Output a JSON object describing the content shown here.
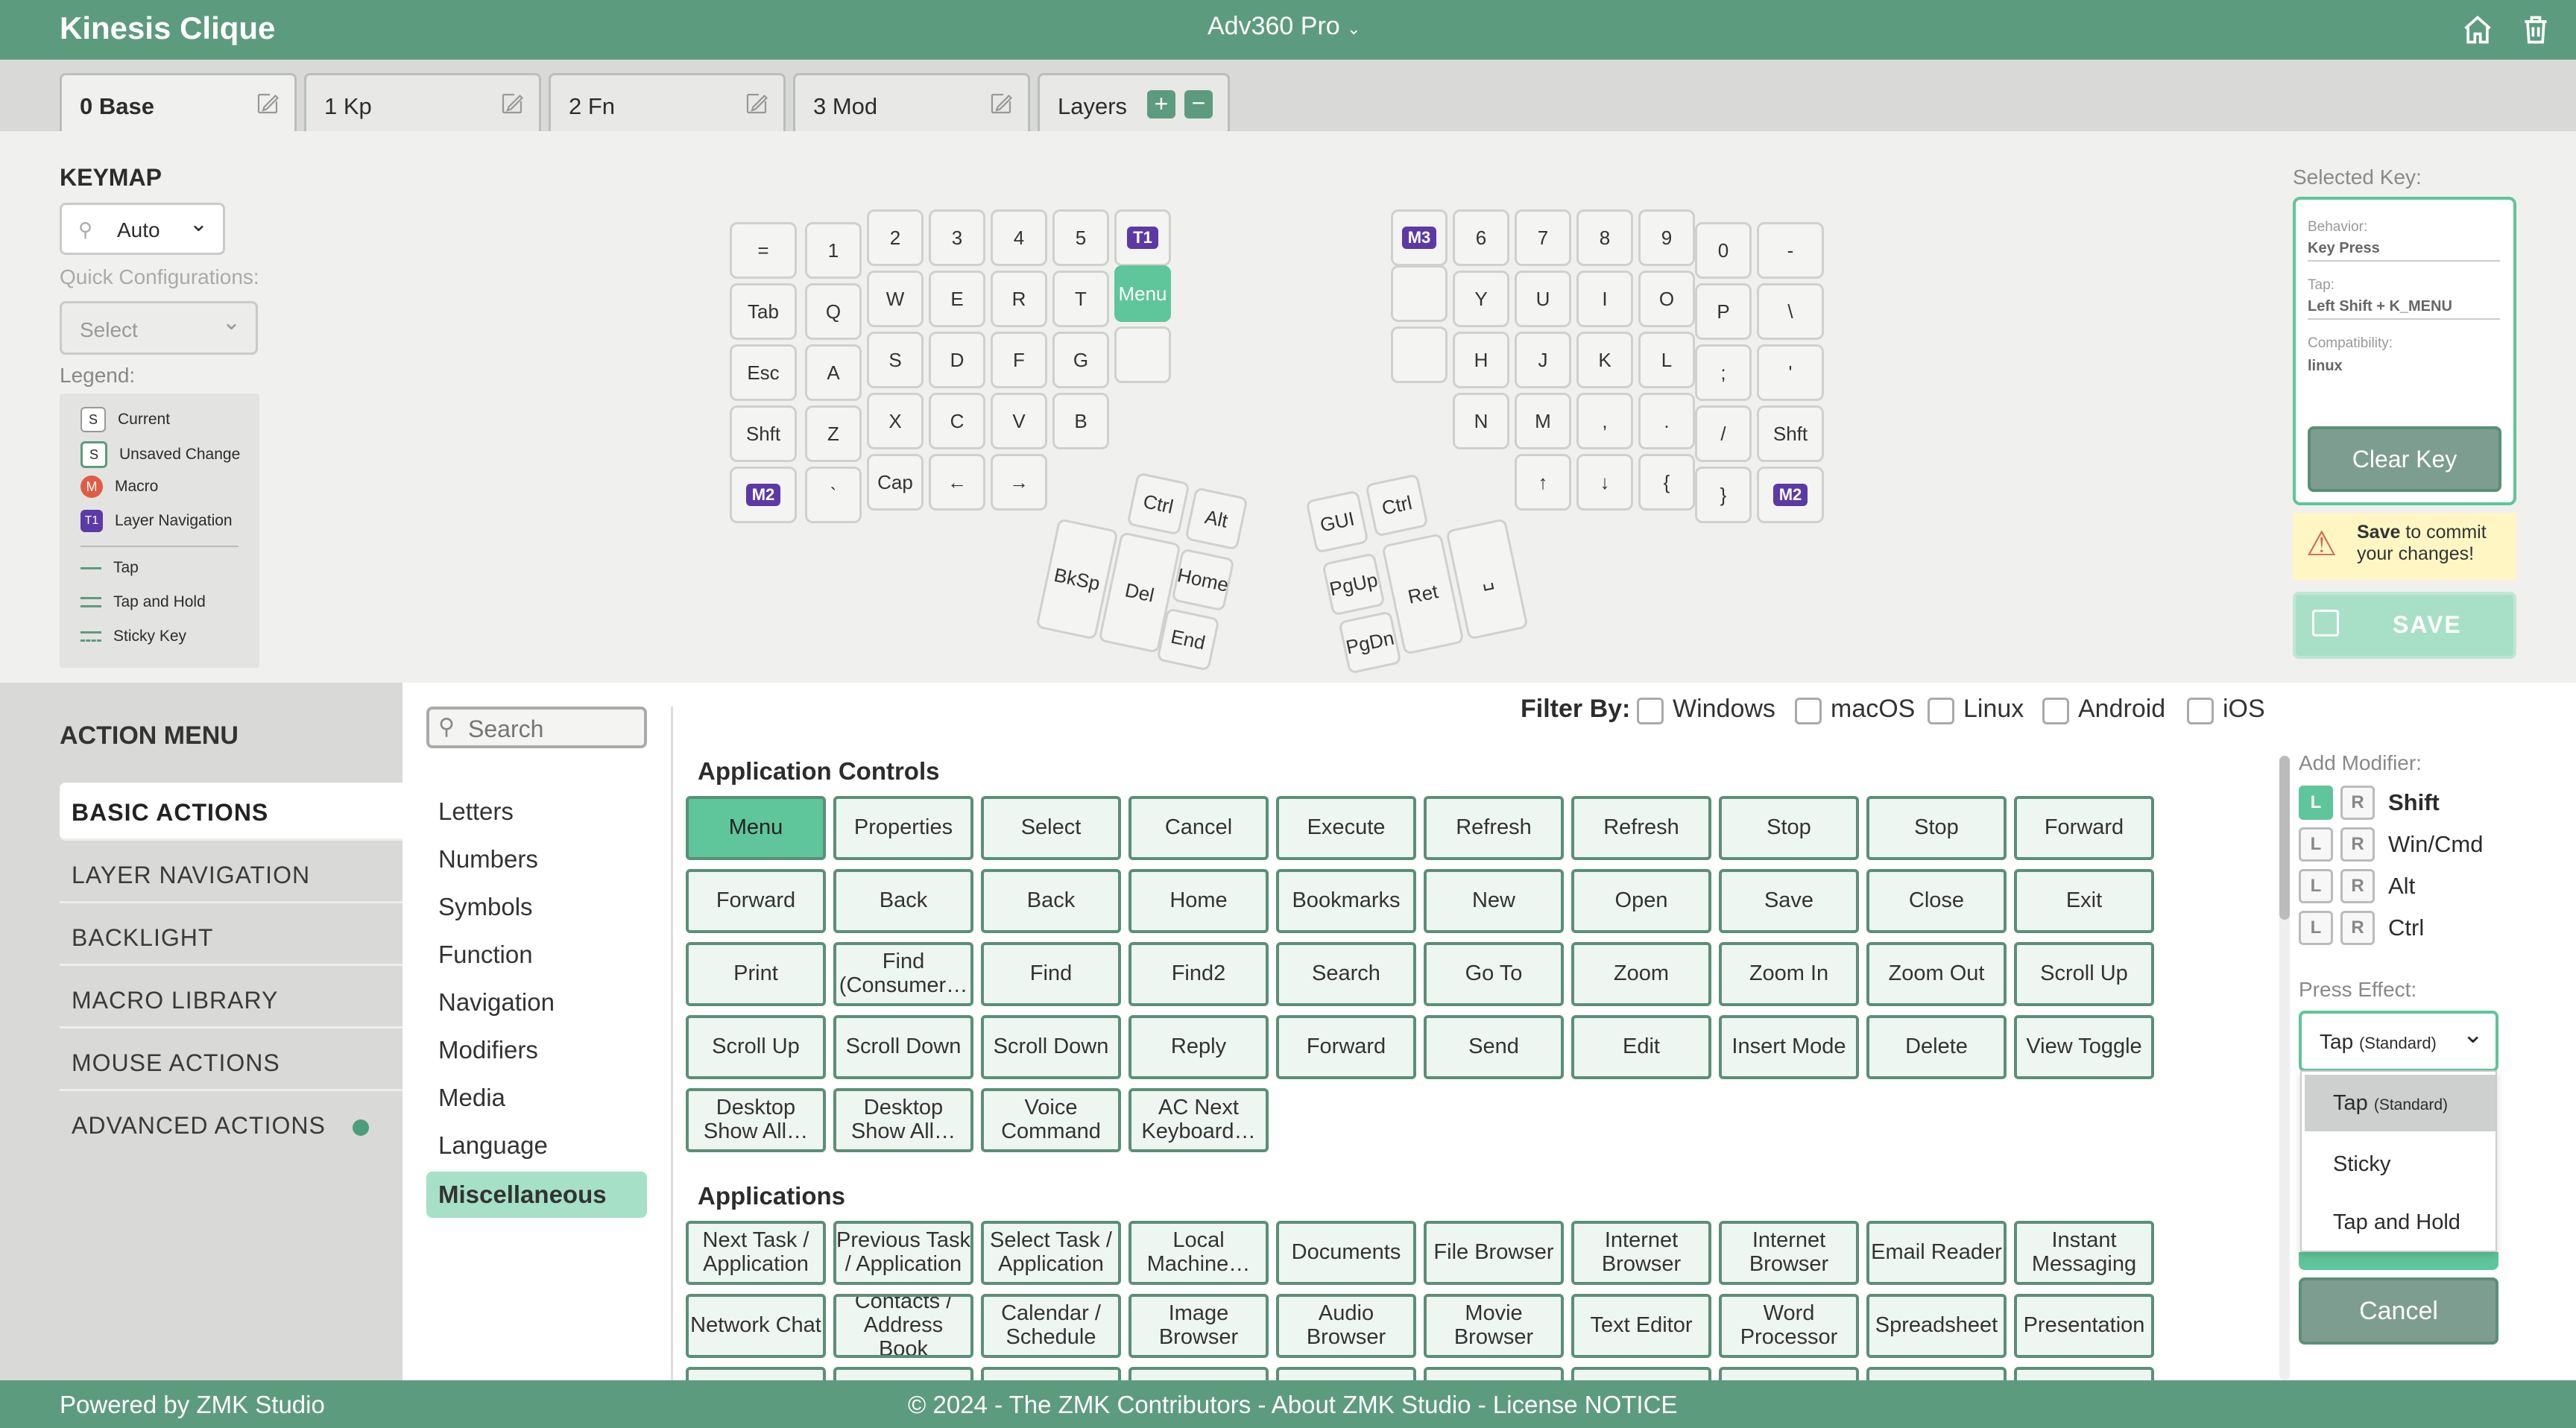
{
  "header": {
    "app_title": "Kinesis Clique",
    "device_name": "Adv360 Pro",
    "home_icon": "home-icon",
    "delete_icon": "trash-icon"
  },
  "tabs": [
    {
      "label": "0 Base",
      "active": true
    },
    {
      "label": "1 Kp"
    },
    {
      "label": "2 Fn"
    },
    {
      "label": "3 Mod"
    }
  ],
  "layers_label": "Layers",
  "keymap": {
    "title": "KEYMAP",
    "mode": "Auto",
    "quick_config_label": "Quick Configurations:",
    "quick_config_value": "Select",
    "legend_label": "Legend:",
    "legend": [
      {
        "sym": "S",
        "label": "Current"
      },
      {
        "sym": "S",
        "label": "Unsaved Change"
      },
      {
        "sym": "M",
        "label": "Macro"
      },
      {
        "sym": "T1",
        "label": "Layer Navigation"
      },
      {
        "sym": "",
        "label": "Tap"
      },
      {
        "sym": "",
        "label": "Tap and Hold"
      },
      {
        "sym": "",
        "label": "Sticky Key"
      }
    ]
  },
  "keys_left": [
    "=",
    "1",
    "2",
    "3",
    "4",
    "5",
    "T1",
    "Tab",
    "Q",
    "W",
    "E",
    "R",
    "T",
    "Menu",
    "Esc",
    "A",
    "S",
    "D",
    "F",
    "G",
    "",
    "Shft",
    "Z",
    "X",
    "C",
    "V",
    "B",
    "M2",
    "`",
    "Cap",
    "←",
    "→",
    "Ctrl",
    "Alt",
    "BkSp",
    "Del",
    "Home",
    "End"
  ],
  "keys_right": [
    "M3",
    "6",
    "7",
    "8",
    "9",
    "0",
    "-",
    "",
    "Y",
    "U",
    "I",
    "O",
    "P",
    "\\",
    "",
    "H",
    "J",
    "K",
    "L",
    ";",
    "'",
    "N",
    "M",
    ",",
    ".",
    "/",
    "Shft",
    "↑",
    "↓",
    "{",
    "}",
    "M2",
    "GUI",
    "Ctrl",
    "PgUp",
    "PgDn",
    "Ret",
    "␣"
  ],
  "selected_key": {
    "title": "Selected Key:",
    "behavior_label": "Behavior:",
    "behavior": "Key Press",
    "tap_label": "Tap:",
    "tap": "Left Shift + K_MENU",
    "compat_label": "Compatibility:",
    "compat": "linux",
    "clear_label": "Clear Key",
    "warn_bold": "Save",
    "warn_rest": " to commit your changes!",
    "save_label": "SAVE"
  },
  "action_menu": {
    "title": "ACTION MENU",
    "items": [
      "BASIC ACTIONS",
      "LAYER NAVIGATION",
      "BACKLIGHT",
      "MACRO LIBRARY",
      "MOUSE ACTIONS",
      "ADVANCED ACTIONS"
    ]
  },
  "search_placeholder": "Search",
  "categories": [
    "Letters",
    "Numbers",
    "Symbols",
    "Function",
    "Navigation",
    "Modifiers",
    "Media",
    "Language",
    "Miscellaneous"
  ],
  "filter": {
    "label": "Filter By:",
    "options": [
      "Windows",
      "macOS",
      "Linux",
      "Android",
      "iOS"
    ]
  },
  "app_controls": {
    "title": "Application Controls",
    "buttons": [
      "Menu",
      "Properties",
      "Select",
      "Cancel",
      "Execute",
      "Refresh",
      "Refresh",
      "Stop",
      "Stop",
      "Forward",
      "Forward",
      "Back",
      "Back",
      "Home",
      "Bookmarks",
      "New",
      "Open",
      "Save",
      "Close",
      "Exit",
      "Print",
      "Find (Consumer…",
      "Find",
      "Find2",
      "Search",
      "Go To",
      "Zoom",
      "Zoom In",
      "Zoom Out",
      "Scroll Up",
      "Scroll Up",
      "Scroll Down",
      "Scroll Down",
      "Reply",
      "Forward",
      "Send",
      "Edit",
      "Insert Mode",
      "Delete",
      "View Toggle",
      "Desktop Show All…",
      "Desktop Show All…",
      "Voice Command",
      "AC Next Keyboard…"
    ]
  },
  "applications": {
    "title": "Applications",
    "buttons": [
      "Next Task / Application",
      "Previous Task / Application",
      "Select Task / Application",
      "Local Machine…",
      "Documents",
      "File Browser",
      "Internet Browser",
      "Internet Browser",
      "Email Reader",
      "Instant Messaging",
      "Network Chat",
      "Contacts / Address Book",
      "Calendar / Schedule",
      "Image Browser",
      "Audio Browser",
      "Movie Browser",
      "Text Editor",
      "Word Processor",
      "Spreadsheet",
      "Presentation"
    ]
  },
  "modifiers": {
    "title": "Add Modifier:",
    "items": [
      {
        "label": "Shift",
        "left_on": true
      },
      {
        "label": "Win/Cmd"
      },
      {
        "label": "Alt"
      },
      {
        "label": "Ctrl"
      }
    ]
  },
  "press_effect": {
    "title": "Press Effect:",
    "value": "Tap",
    "value_sub": "(Standard)",
    "options": [
      {
        "label": "Tap",
        "sub": "(Standard)"
      },
      {
        "label": "Sticky",
        "sub": ""
      },
      {
        "label": "Tap and Hold",
        "sub": ""
      }
    ],
    "cancel_label": "Cancel"
  },
  "footer": {
    "left": "Powered by ZMK Studio",
    "center": "© 2024 - The ZMK Contributors - About ZMK Studio - License NOTICE"
  },
  "colors": {
    "header": "#5d9b7f",
    "accent": "#5fc59a",
    "layer_badge": "#5b3aa5",
    "macro": "#e25c45"
  }
}
